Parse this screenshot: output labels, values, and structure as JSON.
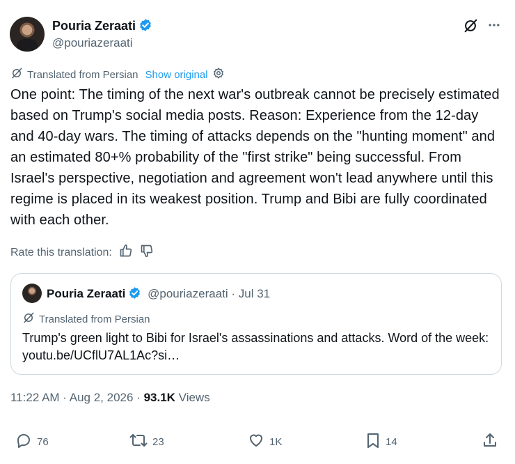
{
  "author": {
    "name": "Pouria Zeraati",
    "handle": "@pouriazeraati"
  },
  "translation": {
    "label": "Translated from Persian",
    "show_original": "Show original"
  },
  "post_text": "One point: The timing of the next war's outbreak cannot be precisely estimated based on Trump's social media posts. Reason: Experience from the 12-day and 40-day wars. The timing of attacks depends on the \"hunting moment\" and an estimated 80+% probability of the \"first strike\" being successful. From Israel's perspective, negotiation and agreement won't lead anywhere until this regime is placed in its weakest position. Trump and Bibi are fully coordinated with each other.",
  "rate_label": "Rate this translation:",
  "quoted": {
    "name": "Pouria Zeraati",
    "handle": "@pouriazeraati",
    "separator": " · ",
    "date": "Jul 31",
    "translation_label": "Translated from Persian",
    "text": "Trump's green light to Bibi for Israel's assassinations and attacks. Word of the week: youtu.be/UCflU7AL1Ac?si…"
  },
  "meta": {
    "time": "11:22 AM",
    "dot": " · ",
    "date": "Aug 2, 2026",
    "views_count": "93.1K",
    "views_label": " Views"
  },
  "actions": {
    "replies": "76",
    "reposts": "23",
    "likes": "1K",
    "bookmarks": "14"
  },
  "colors": {
    "accent": "#1d9bf0",
    "text": "#0f1419",
    "secondary": "#536471",
    "border": "#cfd9de"
  }
}
